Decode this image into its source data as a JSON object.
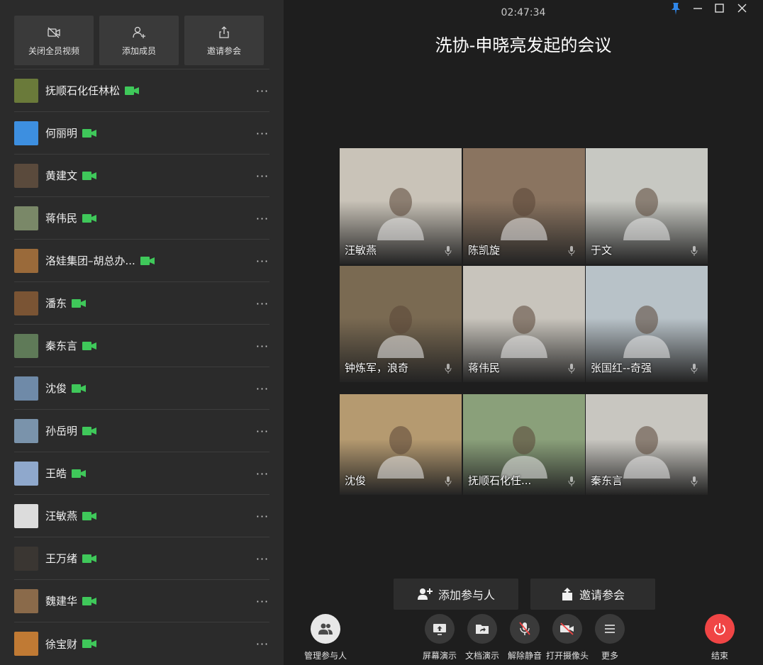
{
  "sidebar": {
    "actions": [
      {
        "label": "关闭全员视频",
        "icon": "video-off-icon"
      },
      {
        "label": "添加成员",
        "icon": "add-user-icon"
      },
      {
        "label": "邀请参会",
        "icon": "share-icon"
      }
    ],
    "members": [
      {
        "name": "抚顺石化任林松",
        "avatar_color": "#6a7a3a"
      },
      {
        "name": "何丽明",
        "avatar_color": "#3d8fe0"
      },
      {
        "name": "黄建文",
        "avatar_color": "#5a4a3c"
      },
      {
        "name": "蒋伟民",
        "avatar_color": "#7a8868"
      },
      {
        "name": "洛娃集团–胡总办...",
        "avatar_color": "#9a6a3a"
      },
      {
        "name": "潘东",
        "avatar_color": "#7a5434"
      },
      {
        "name": "秦东言",
        "avatar_color": "#5f7a58"
      },
      {
        "name": "沈俊",
        "avatar_color": "#6f8aa8"
      },
      {
        "name": "孙岳明",
        "avatar_color": "#7a93ab"
      },
      {
        "name": "王皓",
        "avatar_color": "#8fa8cc"
      },
      {
        "name": "汪敏燕",
        "avatar_color": "#dcdcdc"
      },
      {
        "name": "王万绪",
        "avatar_color": "#3a3632"
      },
      {
        "name": "魏建华",
        "avatar_color": "#8a6a4a"
      },
      {
        "name": "徐宝财",
        "avatar_color": "#c07a34"
      }
    ],
    "more_glyph": "···"
  },
  "main": {
    "timer": "02:47:34",
    "title": "洗协-申晓亮发起的会议",
    "tiles": [
      {
        "label": "汪敏燕",
        "bg": "#c9c3b8"
      },
      {
        "label": "陈凯旋",
        "bg": "#8a7460"
      },
      {
        "label": "于文",
        "bg": "#c7c8c2"
      },
      {
        "label": "钟炼军，浪奇",
        "bg": "#7a6a52"
      },
      {
        "label": "蒋伟民",
        "bg": "#c8c4bc"
      },
      {
        "label": "张国红--奇强",
        "bg": "#b8c2c8"
      },
      {
        "label": "沈俊",
        "bg": "#b59a70"
      },
      {
        "label": "抚顺石化任...",
        "bg": "#8aa07a"
      },
      {
        "label": "秦东言",
        "bg": "#c8c6c0"
      }
    ],
    "buttons": {
      "add_participant": "添加参与人",
      "invite": "邀请参会"
    },
    "toolbar": {
      "manage": "管理参与人",
      "screen_share": "屏幕演示",
      "doc_share": "文档演示",
      "unmute": "解除静音",
      "camera_on": "打开摄像头",
      "more": "更多",
      "end": "结束"
    }
  },
  "colors": {
    "accent_green": "#3fc85a",
    "end_red": "#f04545",
    "pin_blue": "#2f86e8"
  }
}
